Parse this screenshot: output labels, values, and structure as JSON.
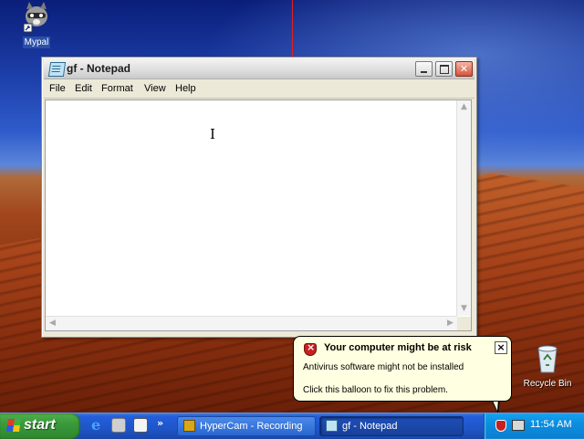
{
  "desktop": {
    "icons": [
      {
        "label": "Mypal",
        "icon": "mypal-raccoon-icon"
      },
      {
        "label": "Recycle Bin",
        "icon": "recycle-bin-icon"
      }
    ]
  },
  "notepad": {
    "title": "gf - Notepad",
    "menu": [
      "File",
      "Edit",
      "Format",
      "View",
      "Help"
    ],
    "content": ""
  },
  "balloon": {
    "title": "Your computer might be at risk",
    "line1": "Antivirus software might not be installed",
    "line2": "Click this balloon to fix this problem.",
    "icon": "security-shield-icon",
    "close_glyph": "×"
  },
  "taskbar": {
    "start_label": "start",
    "quick_launch": [
      "internet-explorer-icon",
      "mypal-icon",
      "editor-icon"
    ],
    "quick_launch_more": "»",
    "tasks": [
      {
        "label": "HyperCam - Recording",
        "active": false
      },
      {
        "label": "gf - Notepad",
        "active": true
      }
    ],
    "clock": "11:54 AM"
  },
  "colors": {
    "taskbar_blue": "#245edb",
    "start_green": "#3a9a3a",
    "tray_blue": "#0d8ee0",
    "balloon_bg": "#ffffe1",
    "recording_region": "#e02020"
  }
}
